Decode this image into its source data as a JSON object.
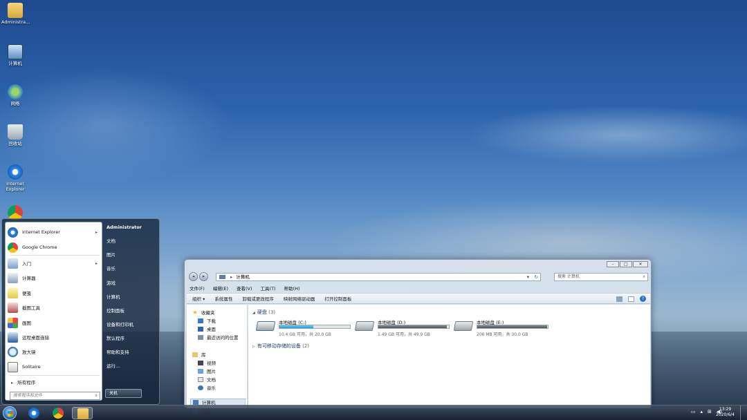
{
  "desktop": {
    "icons": [
      {
        "label": "Administra..."
      },
      {
        "label": "计算机"
      },
      {
        "label": "网络"
      },
      {
        "label": "回收站"
      },
      {
        "label": "Internet Explorer"
      },
      {
        "label": ""
      }
    ]
  },
  "start_menu": {
    "left_items": [
      {
        "label": "Internet Explorer",
        "icon": "ie-icon",
        "has_arrow": true
      },
      {
        "label": "Google Chrome",
        "icon": "chrome-icon",
        "has_arrow": false
      },
      {
        "label": "入门",
        "icon": "getting-started-icon",
        "has_arrow": true
      },
      {
        "label": "计算器",
        "icon": "calculator-icon",
        "has_arrow": false
      },
      {
        "label": "便笺",
        "icon": "sticky-notes-icon",
        "has_arrow": false
      },
      {
        "label": "截图工具",
        "icon": "snipping-tool-icon",
        "has_arrow": false
      },
      {
        "label": "画图",
        "icon": "paint-icon",
        "has_arrow": false
      },
      {
        "label": "远程桌面连接",
        "icon": "remote-desktop-icon",
        "has_arrow": false
      },
      {
        "label": "放大镜",
        "icon": "magnifier-icon",
        "has_arrow": false
      },
      {
        "label": "Solitaire",
        "icon": "solitaire-icon",
        "has_arrow": false
      }
    ],
    "all_programs": "所有程序",
    "search_placeholder": "搜索程序和文件",
    "right_items": [
      {
        "label": "Administrator"
      },
      {
        "label": "文档"
      },
      {
        "label": "图片"
      },
      {
        "label": "音乐"
      },
      {
        "label": "游戏"
      },
      {
        "label": "计算机"
      },
      {
        "label": "控制面板"
      },
      {
        "label": "设备和打印机"
      },
      {
        "label": "默认程序"
      },
      {
        "label": "帮助和支持"
      },
      {
        "label": "运行..."
      }
    ],
    "shutdown_label": "关机"
  },
  "explorer": {
    "address": "计算机",
    "address_chevron": "▸",
    "search_placeholder": "搜索 计算机",
    "menus": [
      "文件(F)",
      "编辑(E)",
      "查看(V)",
      "工具(T)",
      "帮助(H)"
    ],
    "toolbar": [
      "组织 ▾",
      "系统属性",
      "卸载或更改程序",
      "映射网络驱动器",
      "打开控制面板"
    ],
    "nav": {
      "favorites": "收藏夹",
      "favorites_items": [
        "下载",
        "桌面",
        "最近访问的位置"
      ],
      "libraries": "库",
      "library_items": [
        "视频",
        "图片",
        "文档",
        "音乐"
      ],
      "computer": "计算机",
      "network": "网络"
    },
    "hard_disks_group": "硬盘",
    "hard_disks_count": "(3)",
    "removable_group": "有可移动存储的设备",
    "removable_count": "(2)",
    "drives": [
      {
        "name": "本地磁盘 (C:)",
        "size": "10.4 GB 可用，共 20.0 GB",
        "used_fraction": 0.48
      },
      {
        "name": "本地磁盘 (D:)",
        "size": "1.49 GB 可用，共 49.9 GB",
        "used_fraction": 0.97
      },
      {
        "name": "本地磁盘 (E:)",
        "size": "206 MB 可用，共 30.0 GB",
        "used_fraction": 0.99
      }
    ]
  },
  "taskbar": {
    "time": "13:29",
    "date": "2020/6/4"
  }
}
